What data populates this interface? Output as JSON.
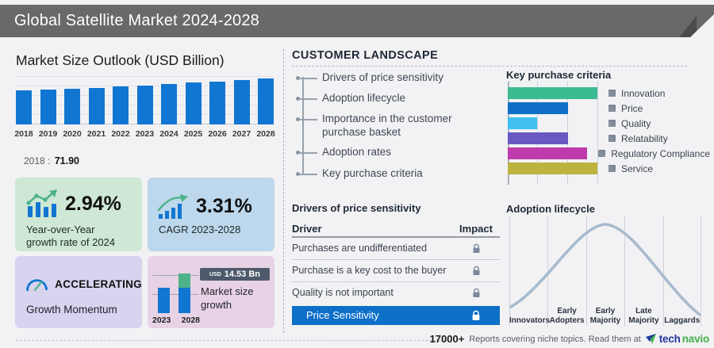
{
  "colors": {
    "accent_blue": "#1176d2",
    "header_gray": "#696969",
    "highlight_row_blue": "#0d6fc8",
    "badge_slate": "#4e5a6c",
    "green_card_bg": "#cfe7d5",
    "blue_card_bg": "#bdd7ec",
    "purple_card_bg": "#d8d3ee",
    "pink_card_bg": "#e8d3e6",
    "growth_green": "#4db38a",
    "lifecycle_curve": "#a9bacd",
    "brand_blue": "#2438a0",
    "brand_green": "#43b049"
  },
  "header": {
    "title": "Global Satellite Market 2024-2028"
  },
  "market_outlook": {
    "title": "Market Size Outlook (USD Billion)",
    "base_year_label": "2018 :",
    "base_year_value": "71.90"
  },
  "stat_cards": {
    "yoy": {
      "value": "2.94%",
      "label": "Year-over-Year growth rate of 2024"
    },
    "cagr": {
      "value": "3.31%",
      "label": "CAGR 2023-2028"
    },
    "momentum": {
      "value": "ACCELERATING",
      "label": "Growth Momentum"
    },
    "size_growth": {
      "currency": "USD",
      "amount": "14.53 Bn",
      "label": "Market size growth",
      "year_start": "2023",
      "year_end": "2028"
    }
  },
  "customer_landscape": {
    "title": "CUSTOMER LANDSCAPE",
    "items": [
      "Drivers of price sensitivity",
      "Adoption lifecycle",
      "Importance in the customer purchase basket",
      "Adoption rates",
      "Key purchase criteria"
    ]
  },
  "price_sensitivity": {
    "title": "Drivers of price sensitivity",
    "columns": [
      "Driver",
      "Impact"
    ],
    "rows": [
      "Purchases are undifferentiated",
      "Purchase is a key cost to the buyer",
      "Quality is not important"
    ],
    "highlight_row": "Price Sensitivity"
  },
  "footer": {
    "count": "17000+",
    "tagline": "Reports covering niche topics. Read them at",
    "brand": {
      "part1": "tech",
      "part2": "navio"
    }
  },
  "chart_data": [
    {
      "id": "market_size_outlook",
      "type": "bar",
      "title": "Market Size Outlook (USD Billion)",
      "categories": [
        "2018",
        "2019",
        "2020",
        "2021",
        "2022",
        "2023",
        "2024",
        "2025",
        "2026",
        "2027",
        "2028"
      ],
      "values": [
        71.9,
        73.6,
        75.3,
        77.1,
        79.3,
        82.5,
        84.9,
        87.6,
        90.5,
        93.6,
        97.0
      ],
      "ylabel": "USD Billion",
      "ylim": [
        0,
        100
      ],
      "bar_color": "#1176d2",
      "grid": true,
      "note": "Only 2018 value (71.90) is labeled on the image; 2024 = 2023 x 1.0294 (YoY 2.94%), 2028 = 2023 + 14.53 Bn (CAGR 3.31%); intermediate values estimated from bar heights"
    },
    {
      "id": "key_purchase_criteria",
      "type": "bar",
      "orientation": "horizontal",
      "title": "Key purchase criteria",
      "categories": [
        "Innovation",
        "Price",
        "Quality",
        "Relatability",
        "Regulatory Compliance",
        "Service"
      ],
      "values": [
        100,
        67,
        33,
        67,
        100,
        100
      ],
      "unit": "relative length %, axis unlabeled; gridlines at 0/33/67/100",
      "colors": [
        "#3cba92",
        "#0f6fc6",
        "#3fc0f0",
        "#6a57c2",
        "#bf3bab",
        "#bcb43f"
      ],
      "legend_position": "right",
      "grid": true
    },
    {
      "id": "adoption_lifecycle",
      "type": "line",
      "title": "Adoption lifecycle",
      "categories": [
        "Innovators",
        "Early Adopters",
        "Early Majority",
        "Late Majority",
        "Laggards"
      ],
      "shape": "bell curve peaking at Early Majority",
      "curve_color": "#a9bacd",
      "grid": true
    },
    {
      "id": "market_size_growth_mini",
      "type": "bar",
      "categories": [
        "2023",
        "2028"
      ],
      "values": [
        82.5,
        97.0
      ],
      "annotation": "USD 14.53 Bn",
      "note": "2028 bar shows the incremental 14.53 Bn as a green top segment; bar values estimated"
    }
  ]
}
